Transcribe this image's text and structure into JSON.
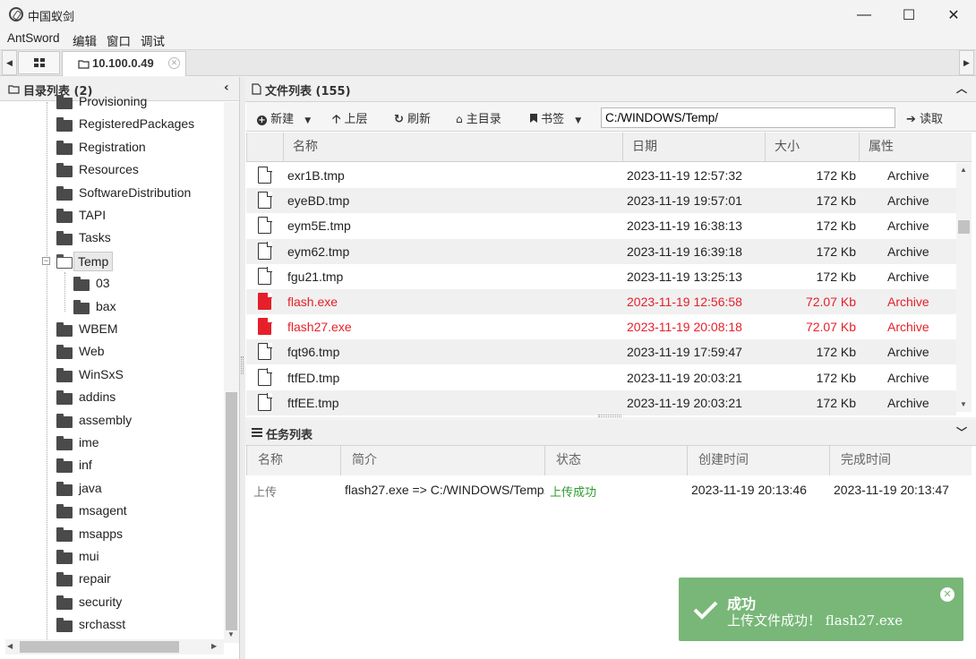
{
  "window": {
    "title": "中国蚁剑",
    "min": "—",
    "max": "☐",
    "close": "✕"
  },
  "menu": [
    "AntSword",
    "编辑",
    "窗口",
    "调试"
  ],
  "tabs": {
    "home_icon": "grid-icon",
    "active_label": "10.100.0.49"
  },
  "left": {
    "header": "目录列表 (2)",
    "items": [
      "Provisioning",
      "RegisteredPackages",
      "Registration",
      "Resources",
      "SoftwareDistribution",
      "TAPI",
      "Tasks",
      "Temp",
      "03",
      "bax",
      "WBEM",
      "Web",
      "WinSxS",
      "addins",
      "assembly",
      "ime",
      "inf",
      "java",
      "msagent",
      "msapps",
      "mui",
      "repair",
      "security",
      "srchasst"
    ]
  },
  "files": {
    "header": "文件列表 (155)",
    "toolbar": {
      "new": "新建",
      "up": "上层",
      "refresh": "刷新",
      "home": "主目录",
      "bookmark": "书签",
      "read": "读取"
    },
    "path": "C:/WINDOWS/Temp/",
    "columns": [
      "名称",
      "日期",
      "大小",
      "属性"
    ],
    "rows": [
      {
        "name": "exr1B.tmp",
        "date": "2023-11-19 12:57:32",
        "size": "172 Kb",
        "attr": "Archive",
        "red": false
      },
      {
        "name": "eyeBD.tmp",
        "date": "2023-11-19 19:57:01",
        "size": "172 Kb",
        "attr": "Archive",
        "red": false
      },
      {
        "name": "eym5E.tmp",
        "date": "2023-11-19 16:38:13",
        "size": "172 Kb",
        "attr": "Archive",
        "red": false
      },
      {
        "name": "eym62.tmp",
        "date": "2023-11-19 16:39:18",
        "size": "172 Kb",
        "attr": "Archive",
        "red": false
      },
      {
        "name": "fgu21.tmp",
        "date": "2023-11-19 13:25:13",
        "size": "172 Kb",
        "attr": "Archive",
        "red": false
      },
      {
        "name": "flash.exe",
        "date": "2023-11-19 12:56:58",
        "size": "72.07 Kb",
        "attr": "Archive",
        "red": true
      },
      {
        "name": "flash27.exe",
        "date": "2023-11-19 20:08:18",
        "size": "72.07 Kb",
        "attr": "Archive",
        "red": true
      },
      {
        "name": "fqt96.tmp",
        "date": "2023-11-19 17:59:47",
        "size": "172 Kb",
        "attr": "Archive",
        "red": false
      },
      {
        "name": "ftfED.tmp",
        "date": "2023-11-19 20:03:21",
        "size": "172 Kb",
        "attr": "Archive",
        "red": false
      },
      {
        "name": "ftfEE.tmp",
        "date": "2023-11-19 20:03:21",
        "size": "172 Kb",
        "attr": "Archive",
        "red": false
      }
    ]
  },
  "tasks": {
    "header": "任务列表",
    "columns": [
      "名称",
      "简介",
      "状态",
      "创建时间",
      "完成时间"
    ],
    "row": {
      "name": "上传",
      "desc": "flash27.exe => C:/WINDOWS/Temp/",
      "status": "上传成功",
      "created": "2023-11-19 20:13:46",
      "finished": "2023-11-19 20:13:47"
    }
  },
  "toast": {
    "title": "成功",
    "message": "上传文件成功！ flash27.exe"
  },
  "colors": {
    "danger": "#e5202a",
    "success_text": "#2e9b2e",
    "toast_bg": "#78b778"
  }
}
